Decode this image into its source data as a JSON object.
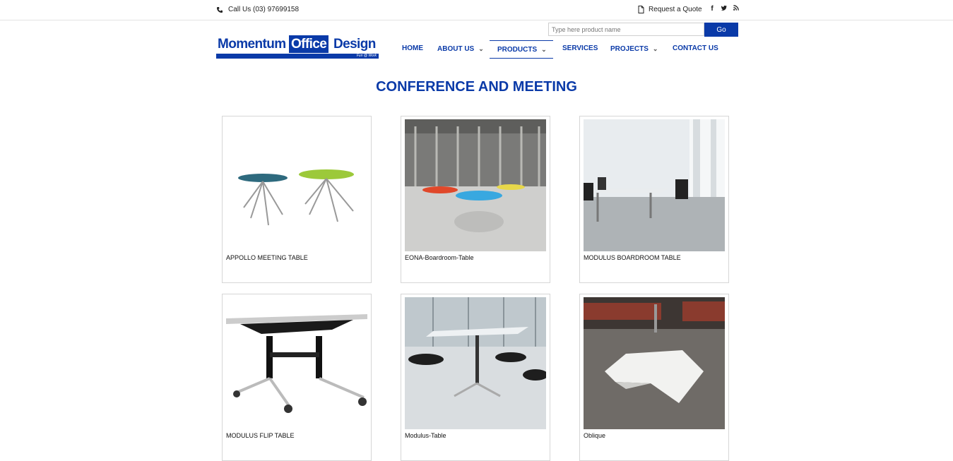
{
  "topbar": {
    "phone_icon": "phone-icon",
    "call_text": "Call Us (03) 97699158",
    "quote_icon": "document-icon",
    "quote_text": "Request a Quote",
    "social": [
      {
        "icon": "facebook-icon",
        "glyph": "f"
      },
      {
        "icon": "twitter-icon",
        "glyph": "t"
      },
      {
        "icon": "rss-icon",
        "glyph": "r"
      }
    ]
  },
  "logo": {
    "word1": "Momentum",
    "word2": "Office",
    "word3": "Design",
    "tagline": "Fun @ Work"
  },
  "search": {
    "placeholder": "Type here product name",
    "button": "Go"
  },
  "nav": {
    "home": "HOME",
    "about": "ABOUT US",
    "products": "PRODUCTS",
    "services": "SERVICES",
    "projects": "PROJECTS",
    "contact": "CONTACT US",
    "active": "PRODUCTS"
  },
  "page": {
    "title": "CONFERENCE AND MEETING"
  },
  "products": [
    {
      "name": "APPOLLO MEETING TABLE"
    },
    {
      "name": "EONA-Boardroom-Table"
    },
    {
      "name": "MODULUS BOARDROOM TABLE"
    },
    {
      "name": "MODULUS FLIP TABLE"
    },
    {
      "name": "Modulus-Table"
    },
    {
      "name": "Oblique"
    }
  ],
  "colors": {
    "brand": "#0a3aa8"
  }
}
